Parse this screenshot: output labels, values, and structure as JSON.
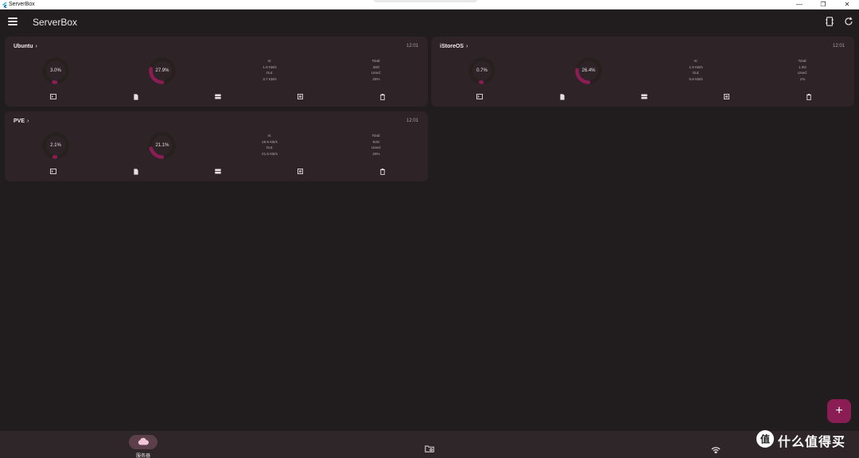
{
  "window": {
    "title": "ServerBox",
    "controls": {
      "minimize": "—",
      "maximize": "❐",
      "close": "✕"
    }
  },
  "appbar": {
    "title": "ServerBox",
    "actions": [
      "server-switch-icon",
      "refresh-icon"
    ]
  },
  "servers": [
    {
      "name": "Ubuntu",
      "time": "12:01",
      "cpu": {
        "label": "3.0%",
        "value": 3.0
      },
      "mem": {
        "label": "27.9%",
        "value": 27.9
      },
      "net": {
        "in_label": "In:",
        "in_value": "1.8 KB/s",
        "out_label": "Out:",
        "out_value": "3.7 KB/s"
      },
      "disk": {
        "total_label": "Total:",
        "total_value": "48G",
        "used_label": "Used:",
        "used_value": "25%"
      }
    },
    {
      "name": "iStoreOS",
      "time": "12:01",
      "cpu": {
        "label": "0.7%",
        "value": 0.7
      },
      "mem": {
        "label": "26.4%",
        "value": 26.4
      },
      "net": {
        "in_label": "In:",
        "in_value": "1.9 KB/s",
        "out_label": "Out:",
        "out_value": "5.8 KB/s"
      },
      "disk": {
        "total_label": "Total:",
        "total_value": "1.9G",
        "used_label": "Used:",
        "used_value": "1%"
      }
    },
    {
      "name": "PVE",
      "time": "12:01",
      "cpu": {
        "label": "2.1%",
        "value": 2.1
      },
      "mem": {
        "label": "21.1%",
        "value": 21.1
      },
      "net": {
        "in_label": "In:",
        "in_value": "19.9 KB/s",
        "out_label": "Out:",
        "out_value": "21.8 KB/s"
      },
      "disk": {
        "total_label": "Total:",
        "total_value": "94G",
        "used_label": "Used:",
        "used_value": "26%"
      }
    }
  ],
  "card_actions": [
    "terminal-icon",
    "file-icon",
    "server-list-icon",
    "docker-icon",
    "delete-icon"
  ],
  "fab": {
    "label": "+"
  },
  "bottom_nav": [
    {
      "label": "服务器",
      "icon": "cloud-icon",
      "active": true
    },
    {
      "label": "",
      "icon": "folder-icon",
      "active": false
    },
    {
      "label": "",
      "icon": "wifi-icon",
      "active": false
    }
  ],
  "colors": {
    "accent": "#8a1d53",
    "card": "#2e2427",
    "background": "#211c1e",
    "track": "#26201f"
  },
  "watermark": {
    "text": "什么值得买"
  }
}
